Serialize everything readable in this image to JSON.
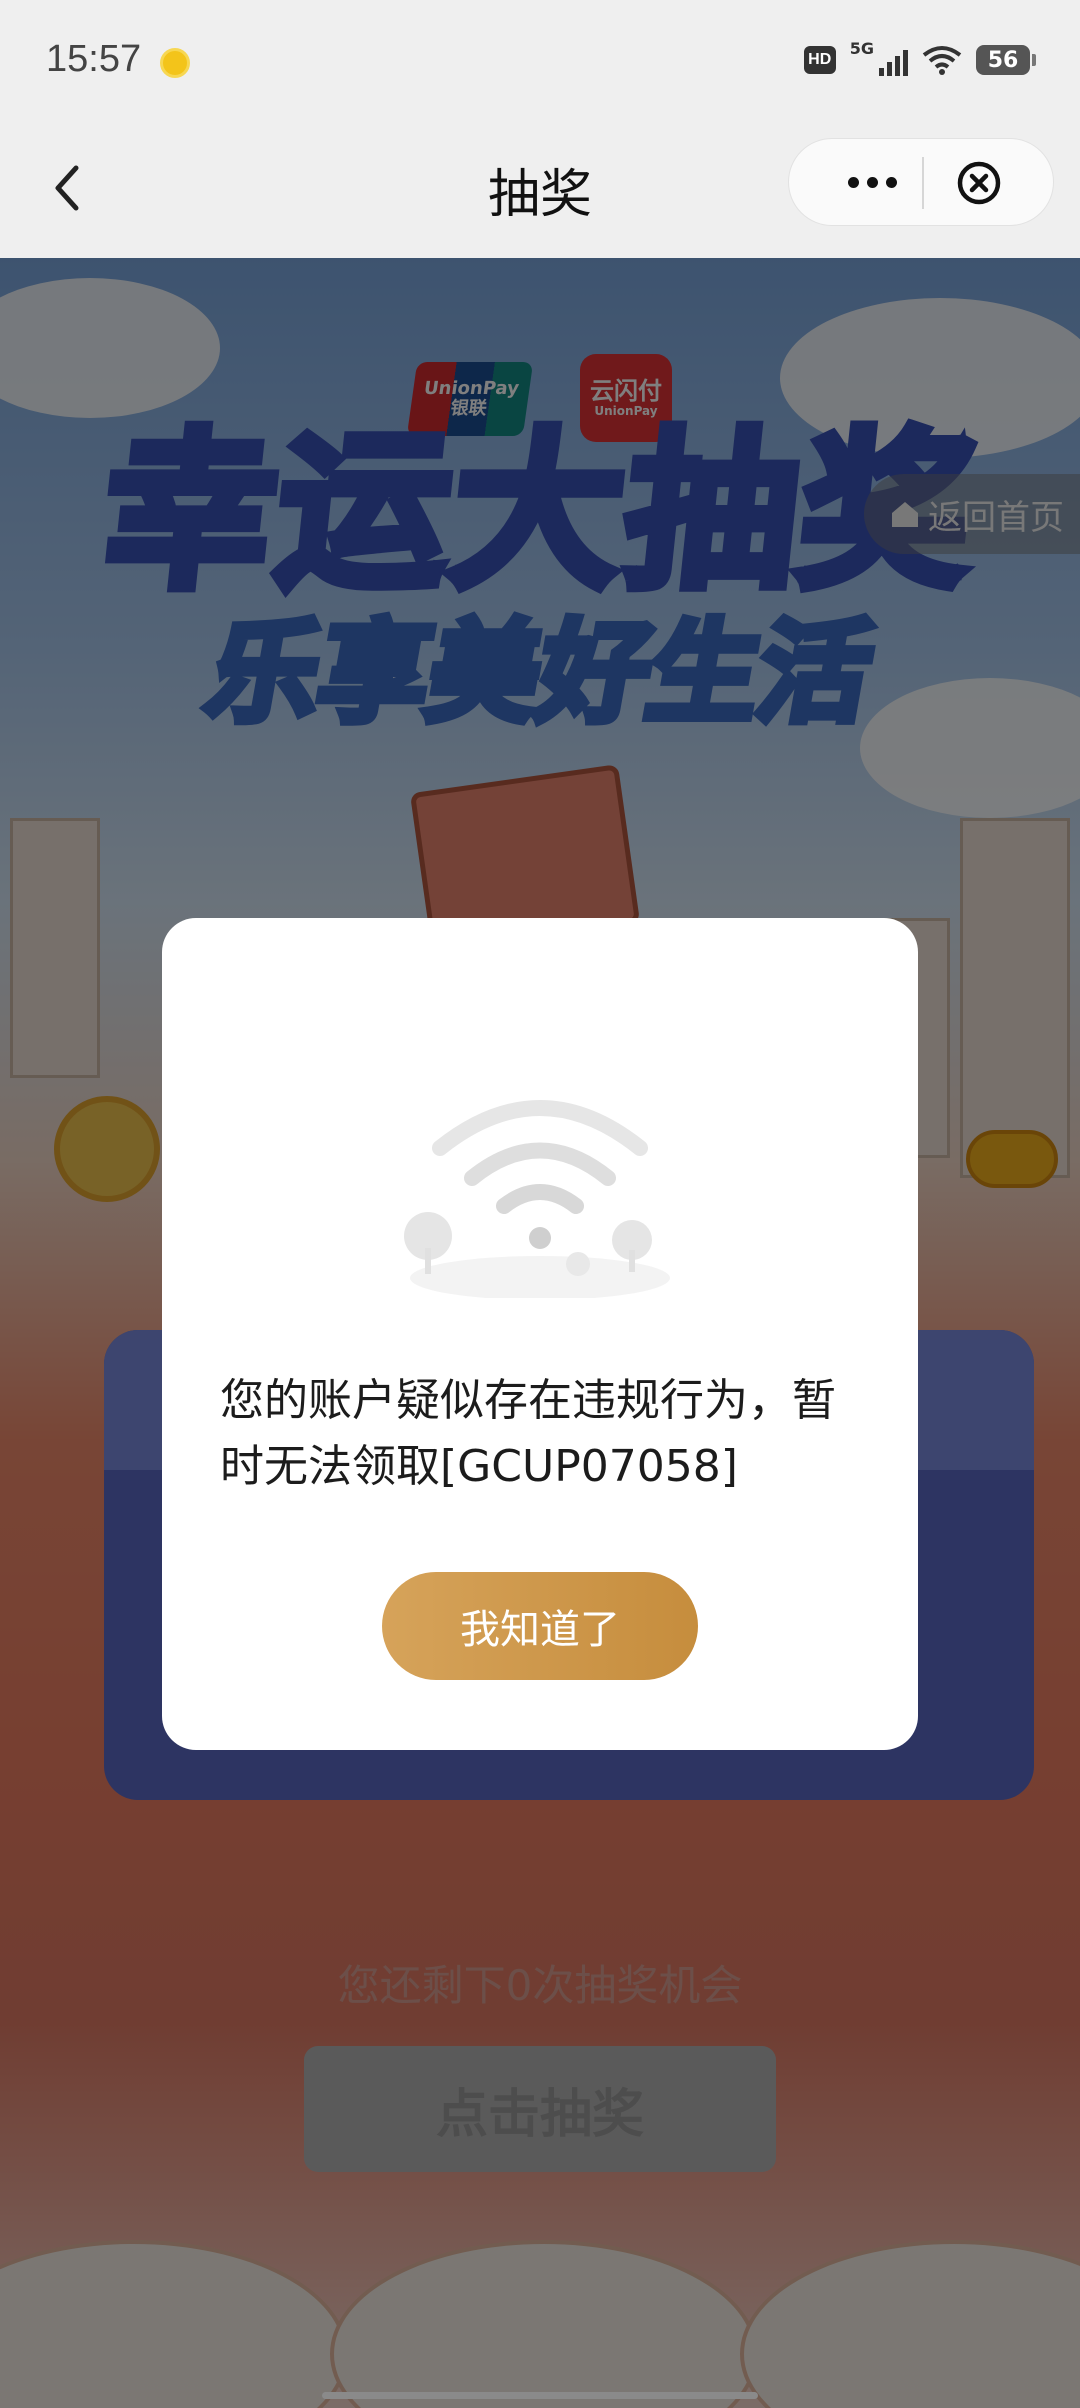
{
  "status_bar": {
    "time": "15:57",
    "network_hd": "HD",
    "network_gen": "5G",
    "battery": "56"
  },
  "nav": {
    "title": "抽奖",
    "back_icon": "chevron-left-icon",
    "more_icon": "more-dots-icon",
    "close_icon": "close-circle-icon"
  },
  "banner": {
    "logo_unionpay_en": "UnionPay",
    "logo_unionpay_cn": "银联",
    "logo_cloudpay_cn": "云闪付",
    "logo_cloudpay_en": "UnionPay",
    "title_line1": "幸运大抽奖",
    "title_line2": "乐享美好生活",
    "home_button": "返回首页"
  },
  "lottery": {
    "remaining_text": "您还剩下0次抽奖机会",
    "draw_button": "点击抽奖"
  },
  "modal": {
    "illustration": "no-network-wifi-illustration",
    "message": "您的账户疑似存在违规行为，暂时无法领取[GCUP07058]",
    "confirm_button": "我知道了"
  },
  "colors": {
    "modal_button_start": "#d6a35a",
    "modal_button_end": "#c68d3d",
    "overlay": "rgba(0,0,0,0.5)"
  }
}
